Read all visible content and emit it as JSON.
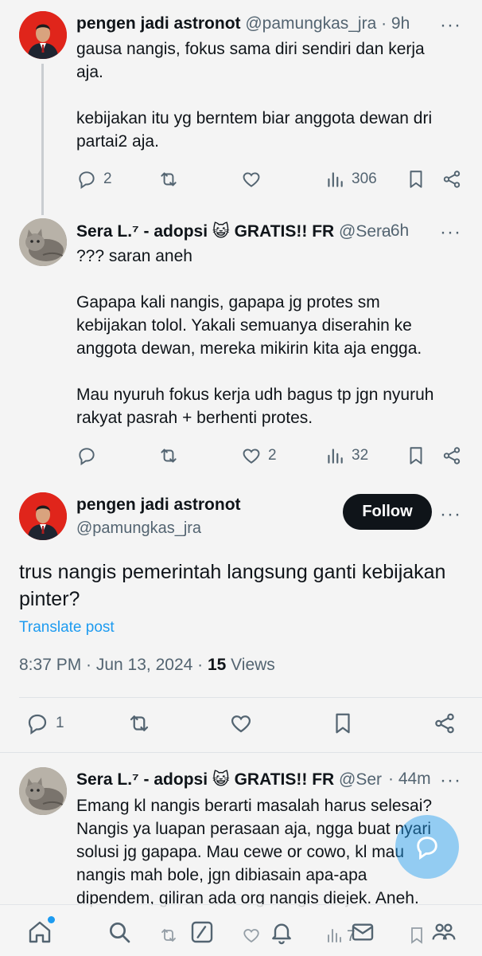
{
  "reply1": {
    "name": "pengen jadi astronot",
    "handle": "@pamungkas_jra",
    "time": "· 9h",
    "text": "gausa nangis, fokus sama diri sendiri dan kerja\naja.\n\nkebijakan itu yg berntem biar anggota dewan dri\npartai2 aja.",
    "replies": "2",
    "reposts": "",
    "likes": "",
    "views": "306"
  },
  "reply2": {
    "name": "Sera L.⁷ - adopsi 😺 GRATIS!! FR",
    "handle": "@Sera",
    "time": "· 6h",
    "text": "??? saran aneh\n\nGapapa kali nangis, gapapa jg protes sm\nkebijakan tolol. Yakali semuanya diserahin ke\nanggota dewan, mereka mikirin kita aja engga.\n\nMau nyuruh fokus kerja udh bagus tp jgn nyuruh\nrakyat pasrah + berhenti protes.",
    "replies": "",
    "reposts": "",
    "likes": "2",
    "views": "32"
  },
  "main_post": {
    "name": "pengen jadi astronot",
    "handle": "@pamungkas_jra",
    "follow_label": "Follow",
    "text": "trus nangis pemerintah langsung ganti kebijakan\npinter?",
    "translate_label": "Translate post",
    "timestamp": "8:37 PM · Jun 13, 2024 · ",
    "views_count": "15",
    "views_label": " Views",
    "replies": "1"
  },
  "reply3": {
    "name": "Sera L.⁷ - adopsi 😺 GRATIS!! FR",
    "handle": "@Ser",
    "time": "· 44m",
    "text": "Emang kl nangis berarti masalah harus selesai?\nNangis ya luapan perasaan aja, ngga buat nyari\nsolusi jg gapapa. Mau cewe or cowo, kl mau\nnangis mah bole, jgn dibiasain apa-apa\ndipendem, giliran ada org nangis diejek. Aneh."
  },
  "more_glyph": "···",
  "bottom_nav": {
    "views_ghost": "7",
    "icons": [
      "home-icon",
      "search-icon",
      "compose-icon",
      "notifications-icon",
      "messages-icon",
      "communities-icon"
    ]
  },
  "colors": {
    "accent": "#1d9bf0",
    "text": "#0f1419",
    "muted": "#536471",
    "follow_bg": "#0f1419"
  }
}
